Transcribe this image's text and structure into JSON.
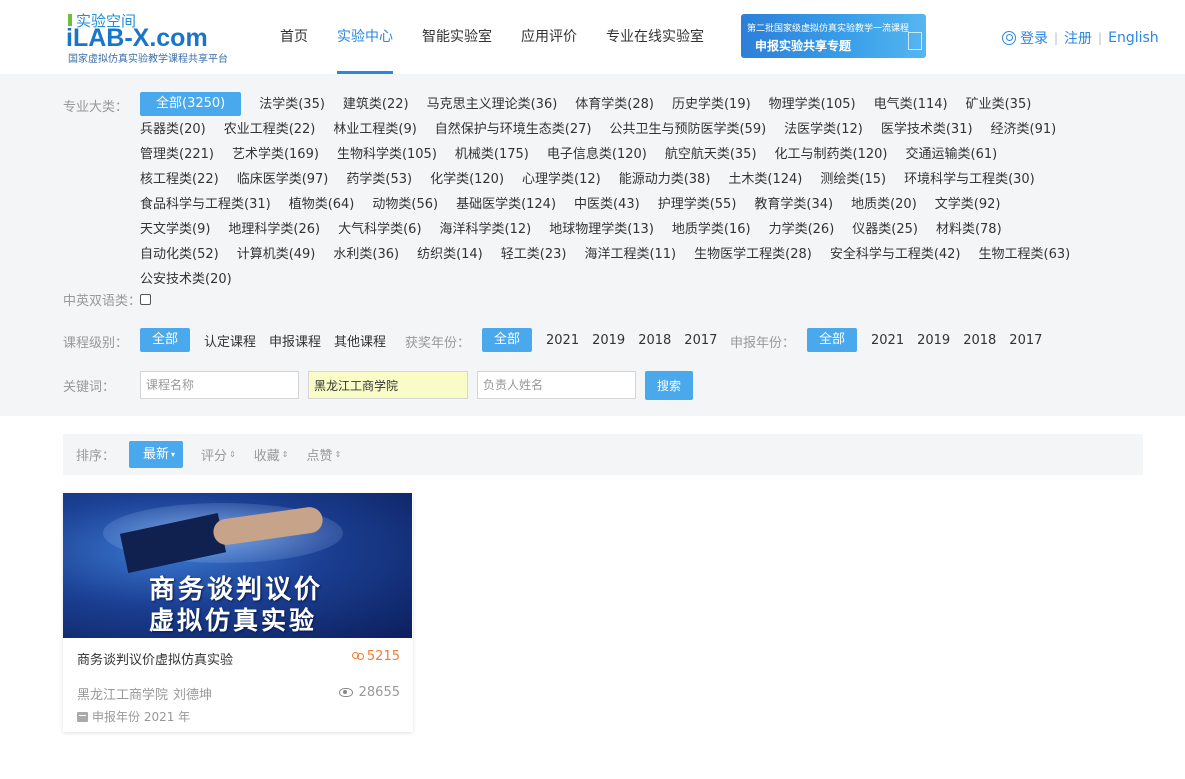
{
  "logo": {
    "top_text": "实验空间",
    "brand": "iLAB-X.com",
    "subtitle": "国家虚拟仿真实验教学课程共享平台"
  },
  "nav": {
    "items": [
      "首页",
      "实验中心",
      "智能实验室",
      "应用评价",
      "专业在线实验室"
    ],
    "active_index": 1
  },
  "banner": {
    "line1": "第二批国家级虚拟仿真实验教学一流课程",
    "line2": "申报实验共享专题"
  },
  "user": {
    "login": "登录",
    "register": "注册",
    "language": "English"
  },
  "filters": {
    "major_label": "专业大类：",
    "majors": [
      "全部(3250)",
      "法学类(35)",
      "建筑类(22)",
      "马克思主义理论类(36)",
      "体育学类(28)",
      "历史学类(19)",
      "物理学类(105)",
      "电气类(114)",
      "矿业类(35)",
      "兵器类(20)",
      "农业工程类(22)",
      "林业工程类(9)",
      "自然保护与环境生态类(27)",
      "公共卫生与预防医学类(59)",
      "法医学类(12)",
      "医学技术类(31)",
      "经济类(91)",
      "管理类(221)",
      "艺术学类(169)",
      "生物科学类(105)",
      "机械类(175)",
      "电子信息类(120)",
      "航空航天类(35)",
      "化工与制药类(120)",
      "交通运输类(61)",
      "核工程类(22)",
      "临床医学类(97)",
      "药学类(53)",
      "化学类(120)",
      "心理学类(12)",
      "能源动力类(38)",
      "土木类(124)",
      "测绘类(15)",
      "环境科学与工程类(30)",
      "食品科学与工程类(31)",
      "植物类(64)",
      "动物类(56)",
      "基础医学类(124)",
      "中医类(43)",
      "护理学类(55)",
      "教育学类(34)",
      "地质类(20)",
      "文学类(92)",
      "天文学类(9)",
      "地理科学类(26)",
      "大气科学类(6)",
      "海洋科学类(12)",
      "地球物理学类(13)",
      "地质学类(16)",
      "力学类(26)",
      "仪器类(25)",
      "材料类(78)",
      "自动化类(52)",
      "计算机类(49)",
      "水利类(36)",
      "纺织类(14)",
      "轻工类(23)",
      "海洋工程类(11)",
      "生物医学工程类(28)",
      "安全科学与工程类(42)",
      "生物工程类(63)",
      "公安技术类(20)"
    ],
    "bilingual_label": "中英双语类：",
    "bilingual_checked": false,
    "level_label": "课程级别：",
    "levels": [
      "全部",
      "认定课程",
      "申报课程",
      "其他课程"
    ],
    "award_label": "获奖年份：",
    "award_years": [
      "全部",
      "2021",
      "2019",
      "2018",
      "2017"
    ],
    "apply_label": "申报年份：",
    "apply_years": [
      "全部",
      "2021",
      "2019",
      "2018",
      "2017"
    ],
    "keyword_label": "关键词：",
    "course_name_placeholder": "课程名称",
    "school_value": "黑龙江工商学院",
    "owner_placeholder": "负责人姓名",
    "search_button": "搜索"
  },
  "sort": {
    "label": "排序：",
    "options": [
      "最新",
      "评分",
      "收藏",
      "点赞"
    ],
    "active_index": 0
  },
  "cards": [
    {
      "thumb_line1": "商务谈判议价",
      "thumb_line2": "虚拟仿真实验",
      "title": "商务谈判议价虚拟仿真实验",
      "participants": "5215",
      "school": "黑龙江工商学院",
      "owner": "刘德坤",
      "views": "28655",
      "year": "申报年份 2021 年"
    }
  ],
  "colors": {
    "accent": "#4aa8ec",
    "nav_active": "#2b86e0",
    "participants": "#f07c32"
  }
}
